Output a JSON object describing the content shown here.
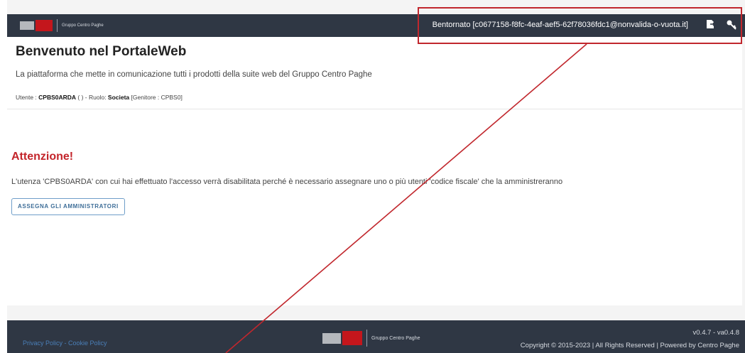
{
  "header": {
    "logo_text": "Gruppo Centro Paghe",
    "welcome_text": "Bentornato [c0677158-f8fc-4eaf-aef5-62f78036fdc1@nonvalida-o-vuota.it]",
    "logout_icon": "logout-icon",
    "key_icon": "key-icon"
  },
  "welcome_card": {
    "title": "Benvenuto nel PortaleWeb",
    "subtitle": "La piattaforma che mette in comunicazione tutti i prodotti della suite web del Gruppo Centro Paghe",
    "user_label": "Utente : ",
    "user_value": "CPBS0ARDA",
    "user_paren": " ( ) - Ruolo: ",
    "role_value": "Societa",
    "parent_text": " [Genitore : CPBS0]"
  },
  "alert": {
    "title": "Attenzione!",
    "message": "L'utenza 'CPBS0ARDA' con cui hai effettuato l'accesso verrà disabilitata perché è necessario assegnare uno o più utenti 'codice fiscale' che la amministreranno",
    "button_label": "ASSEGNA GLI AMMINISTRATORI"
  },
  "footer": {
    "privacy_label": "Privacy Policy",
    "separator": " - ",
    "cookie_label": "Cookie Policy",
    "logo_text": "Gruppo Centro Paghe",
    "version": "v0.4.7 - va0.4.8",
    "copyright": "Copyright © 2015-2023 | All Rights Reserved | Powered by Centro Paghe"
  },
  "colors": {
    "topbar": "#2f3744",
    "accent_red": "#c3242a",
    "annotation": "#c1272d",
    "link": "#4a7fb8"
  }
}
